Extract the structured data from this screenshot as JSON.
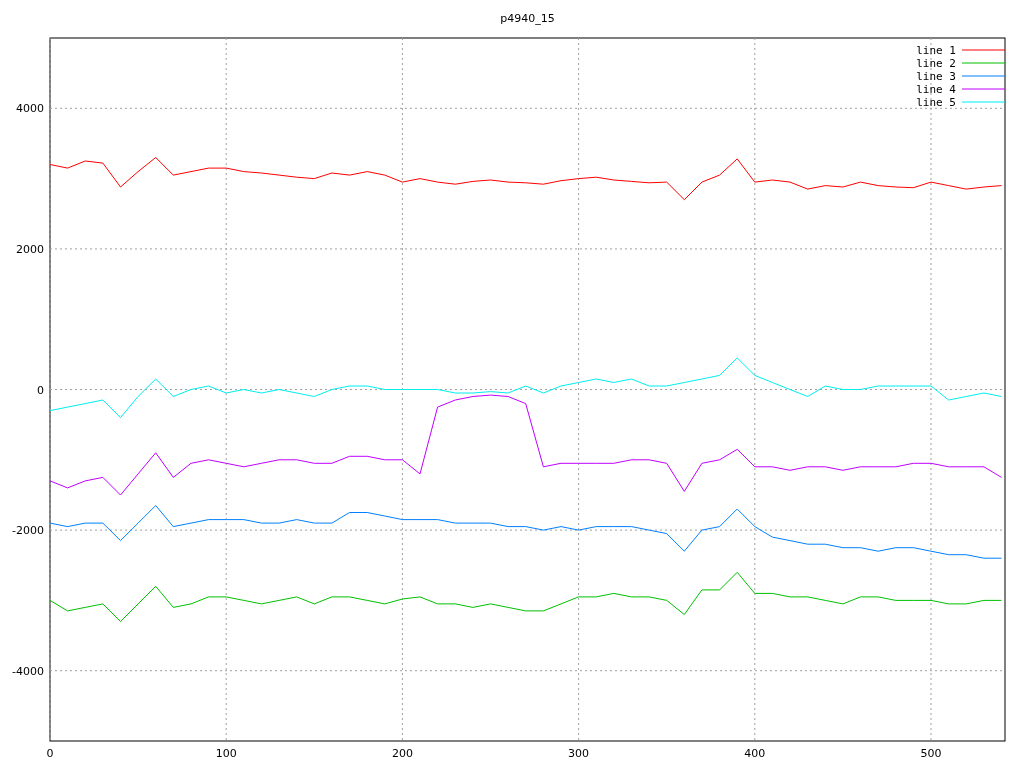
{
  "chart_data": {
    "type": "line",
    "title": "p4940_15",
    "xlim": [
      0,
      542
    ],
    "ylim": [
      -5000,
      5000
    ],
    "xticks": [
      0,
      100,
      200,
      300,
      400,
      500
    ],
    "yticks": [
      -4000,
      -2000,
      0,
      2000,
      4000
    ],
    "grid": true,
    "legend": true,
    "x": [
      0,
      10,
      20,
      30,
      40,
      50,
      60,
      70,
      80,
      90,
      100,
      110,
      120,
      130,
      140,
      150,
      160,
      170,
      180,
      190,
      200,
      210,
      220,
      230,
      240,
      250,
      260,
      270,
      280,
      290,
      300,
      310,
      320,
      330,
      340,
      350,
      360,
      370,
      380,
      390,
      400,
      410,
      420,
      430,
      440,
      450,
      460,
      470,
      480,
      490,
      500,
      510,
      520,
      530,
      540
    ],
    "series": [
      {
        "name": "line 1",
        "color": "#ff0000",
        "values": [
          3200,
          3150,
          3250,
          3220,
          2880,
          3100,
          3300,
          3050,
          3100,
          3150,
          3150,
          3100,
          3080,
          3050,
          3020,
          3000,
          3080,
          3050,
          3100,
          3050,
          2950,
          3000,
          2950,
          2920,
          2960,
          2980,
          2950,
          2940,
          2920,
          2970,
          3000,
          3020,
          2980,
          2960,
          2940,
          2950,
          2700,
          2950,
          3050,
          3280,
          2950,
          2980,
          2950,
          2850,
          2900,
          2880,
          2950,
          2900,
          2880,
          2870,
          2950,
          2900,
          2850,
          2880,
          2900
        ]
      },
      {
        "name": "line 2",
        "color": "#00c000",
        "values": [
          -3000,
          -3150,
          -3100,
          -3050,
          -3300,
          -3050,
          -2800,
          -3100,
          -3050,
          -2950,
          -2950,
          -3000,
          -3050,
          -3000,
          -2950,
          -3050,
          -2950,
          -2950,
          -3000,
          -3050,
          -2980,
          -2950,
          -3050,
          -3050,
          -3100,
          -3050,
          -3100,
          -3150,
          -3150,
          -3050,
          -2950,
          -2950,
          -2900,
          -2950,
          -2950,
          -3000,
          -3200,
          -2850,
          -2850,
          -2600,
          -2900,
          -2900,
          -2950,
          -2950,
          -3000,
          -3050,
          -2950,
          -2950,
          -3000,
          -3000,
          -3000,
          -3050,
          -3050,
          -3000,
          -3000
        ]
      },
      {
        "name": "line 3",
        "color": "#0080ff",
        "values": [
          -1900,
          -1950,
          -1900,
          -1900,
          -2150,
          -1900,
          -1650,
          -1950,
          -1900,
          -1850,
          -1850,
          -1850,
          -1900,
          -1900,
          -1850,
          -1900,
          -1900,
          -1750,
          -1750,
          -1800,
          -1850,
          -1850,
          -1850,
          -1900,
          -1900,
          -1900,
          -1950,
          -1950,
          -2000,
          -1950,
          -2000,
          -1950,
          -1950,
          -1950,
          -2000,
          -2050,
          -2300,
          -2000,
          -1950,
          -1700,
          -1950,
          -2100,
          -2150,
          -2200,
          -2200,
          -2250,
          -2250,
          -2300,
          -2250,
          -2250,
          -2300,
          -2350,
          -2350,
          -2400,
          -2400
        ]
      },
      {
        "name": "line 4",
        "color": "#c000ff",
        "values": [
          -1300,
          -1400,
          -1300,
          -1250,
          -1500,
          -1200,
          -900,
          -1250,
          -1050,
          -1000,
          -1050,
          -1100,
          -1050,
          -1000,
          -1000,
          -1050,
          -1050,
          -950,
          -950,
          -1000,
          -1000,
          -1200,
          -250,
          -150,
          -100,
          -80,
          -100,
          -200,
          -1100,
          -1050,
          -1050,
          -1050,
          -1050,
          -1000,
          -1000,
          -1050,
          -1450,
          -1050,
          -1000,
          -850,
          -1100,
          -1100,
          -1150,
          -1100,
          -1100,
          -1150,
          -1100,
          -1100,
          -1100,
          -1050,
          -1050,
          -1100,
          -1100,
          -1100,
          -1250
        ]
      },
      {
        "name": "line 5",
        "color": "#00eeee",
        "values": [
          -300,
          -250,
          -200,
          -150,
          -400,
          -100,
          150,
          -100,
          0,
          50,
          -50,
          0,
          -50,
          0,
          -50,
          -100,
          0,
          50,
          50,
          0,
          0,
          0,
          0,
          -50,
          -50,
          -30,
          -50,
          50,
          -50,
          50,
          100,
          150,
          100,
          150,
          50,
          50,
          100,
          150,
          200,
          450,
          200,
          100,
          0,
          -100,
          50,
          0,
          0,
          50,
          50,
          50,
          50,
          -150,
          -100,
          -50,
          -100
        ]
      }
    ]
  }
}
